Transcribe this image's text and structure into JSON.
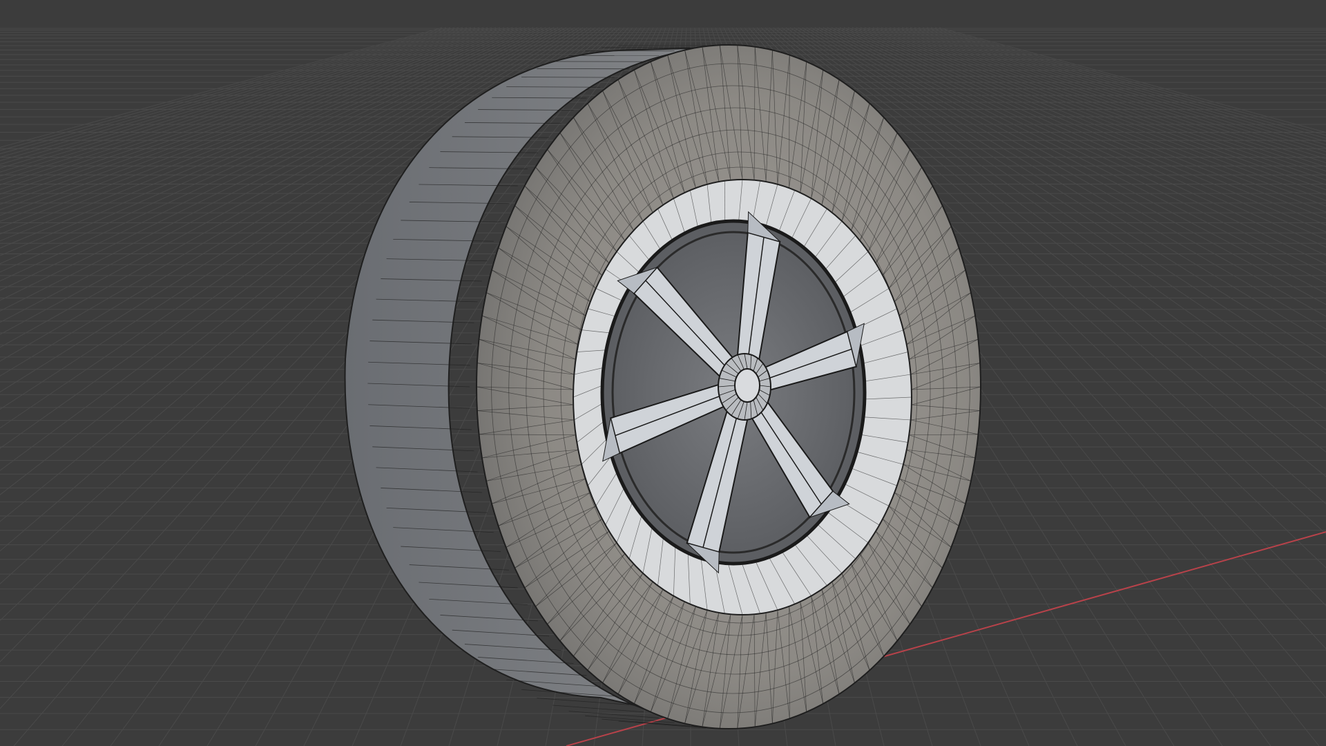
{
  "app": "3d-viewport",
  "viewport": {
    "background_color": "#3c3c3c",
    "grid": true,
    "grid_line_color": "#4a4a4a",
    "x_axis_color": "#b8424a",
    "shading": "solid-with-wireframe-overlay"
  },
  "object": {
    "name_visible": false,
    "type": "car-wheel",
    "parts": [
      "tire",
      "rim-lip",
      "spokes",
      "hub"
    ],
    "spoke_count": 6,
    "tire_color": "#8d8b88",
    "tire_shadow_color": "#6c6d70",
    "rim_color": "#cfd3d8",
    "wire_color": "#1f1f1f"
  }
}
